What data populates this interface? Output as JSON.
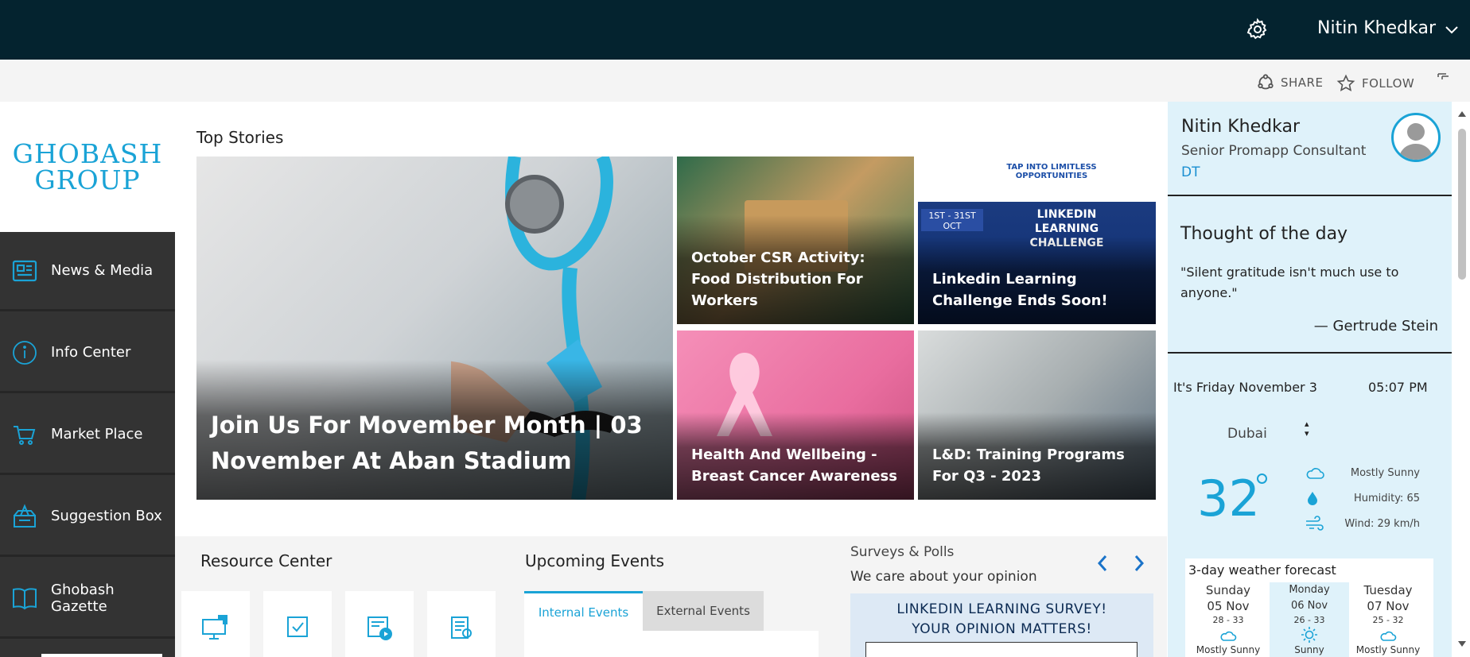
{
  "header": {
    "user_name": "Nitin Khedkar",
    "icons": [
      "gear-icon",
      "chevron-down-icon"
    ]
  },
  "commands": {
    "share": "SHARE",
    "follow": "FOLLOW"
  },
  "logo": {
    "line1": "GHOBASH",
    "line2": "GROUP"
  },
  "nav": {
    "items": [
      {
        "label": "News & Media",
        "icon": "newspaper-icon"
      },
      {
        "label": "Info Center",
        "icon": "info-icon"
      },
      {
        "label": "Market Place",
        "icon": "cart-icon"
      },
      {
        "label": "Suggestion Box",
        "icon": "suggestion-box-icon"
      },
      {
        "label": "Ghobash Gazette",
        "icon": "book-icon"
      }
    ]
  },
  "top_stories": {
    "title": "Top Stories",
    "main": "Join Us For Movember Month | 03 November At Aban Stadium",
    "tiles": [
      "October CSR Activity: Food Distribution For Workers",
      "Linkedin Learning Challenge Ends Soon!",
      "Health And Wellbeing - Breast Cancer Awareness",
      "L&D: Training Programs For Q3 - 2023"
    ],
    "banner": {
      "headline": "TAP INTO LIMITLESS OPPORTUNITIES",
      "dates": "1ST - 31ST OCT",
      "challenge": "LINKEDIN LEARNING CHALLENGE"
    }
  },
  "resource_center": {
    "title": "Resource Center",
    "cards": [
      "monitor-icon",
      "checkbox-icon",
      "video-icon",
      "document-icon"
    ]
  },
  "events": {
    "title": "Upcoming Events",
    "tabs": [
      "Internal Events",
      "External Events"
    ],
    "active_tab": "Internal Events"
  },
  "surveys": {
    "title": "Surveys & Polls",
    "subtitle": "We care about your opinion",
    "survey_line1": "LINKEDIN LEARNING SURVEY!",
    "survey_line2": "YOUR OPINION MATTERS!"
  },
  "profile": {
    "name": "Nitin Khedkar",
    "role": "Senior Promapp Consultant",
    "dept": "DT"
  },
  "thought": {
    "title": "Thought of the day",
    "quote": "\"Silent gratitude isn't much use to anyone.\"",
    "author": "— Gertrude Stein"
  },
  "weather": {
    "date": "It's Friday November 3",
    "time": "05:07 PM",
    "city": "Dubai",
    "temp": "32",
    "condition": "Mostly Sunny",
    "humidity": "Humidity: 65",
    "wind": "Wind: 29 km/h",
    "forecast_title": "3-day weather forecast",
    "forecast": [
      {
        "day": "Sunday",
        "date": "05 Nov",
        "range": "28 - 33",
        "cond": "Mostly Sunny"
      },
      {
        "day": "Monday",
        "date": "06 Nov",
        "range": "26 - 33",
        "cond": "Sunny"
      },
      {
        "day": "Tuesday",
        "date": "07 Nov",
        "range": "25 - 32",
        "cond": "Mostly Sunny"
      }
    ]
  },
  "colors": {
    "topbar": "#04232f",
    "accent": "#1aa3d6",
    "nav_bg": "#333333",
    "panel_bg": "#dff2fa"
  }
}
